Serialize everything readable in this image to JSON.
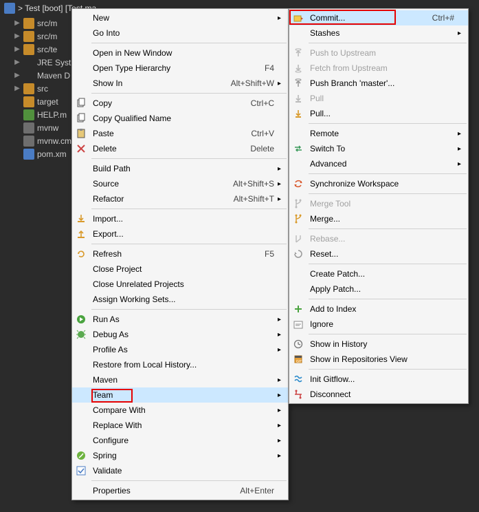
{
  "title_bar": {
    "text": "> Test [boot] [Test ma..."
  },
  "tree": [
    {
      "arrow": true,
      "icon": "pkg",
      "label": "src/m"
    },
    {
      "arrow": true,
      "icon": "pkg",
      "label": "src/m"
    },
    {
      "arrow": true,
      "icon": "pkg",
      "label": "src/te"
    },
    {
      "arrow": true,
      "icon": "jar",
      "label": "JRE Syst"
    },
    {
      "arrow": true,
      "icon": "jar",
      "label": "Maven D"
    },
    {
      "arrow": true,
      "icon": "folder",
      "label": "src"
    },
    {
      "arrow": false,
      "icon": "folder",
      "label": "target"
    },
    {
      "arrow": false,
      "icon": "green",
      "label": "HELP.m"
    },
    {
      "arrow": false,
      "icon": "txt",
      "label": "mvnw"
    },
    {
      "arrow": false,
      "icon": "txt",
      "label": "mvnw.cm"
    },
    {
      "arrow": false,
      "icon": "xml",
      "label": "pom.xm"
    }
  ],
  "primary_menu": [
    {
      "label": "New",
      "submenu": true
    },
    {
      "label": "Go Into"
    },
    {
      "sep": true
    },
    {
      "label": "Open in New Window"
    },
    {
      "label": "Open Type Hierarchy",
      "accel": "F4"
    },
    {
      "label": "Show In",
      "accel": "Alt+Shift+W",
      "submenu": true
    },
    {
      "sep": true
    },
    {
      "icon": "copy",
      "label": "Copy",
      "accel": "Ctrl+C"
    },
    {
      "icon": "copy",
      "label": "Copy Qualified Name"
    },
    {
      "icon": "paste",
      "label": "Paste",
      "accel": "Ctrl+V"
    },
    {
      "icon": "delete",
      "label": "Delete",
      "accel": "Delete"
    },
    {
      "sep": true
    },
    {
      "label": "Build Path",
      "submenu": true
    },
    {
      "label": "Source",
      "accel": "Alt+Shift+S",
      "submenu": true
    },
    {
      "label": "Refactor",
      "accel": "Alt+Shift+T",
      "submenu": true
    },
    {
      "sep": true
    },
    {
      "icon": "import",
      "label": "Import..."
    },
    {
      "icon": "export",
      "label": "Export..."
    },
    {
      "sep": true
    },
    {
      "icon": "refresh",
      "label": "Refresh",
      "accel": "F5"
    },
    {
      "label": "Close Project"
    },
    {
      "label": "Close Unrelated Projects"
    },
    {
      "label": "Assign Working Sets..."
    },
    {
      "sep": true
    },
    {
      "icon": "run",
      "label": "Run As",
      "submenu": true
    },
    {
      "icon": "debug",
      "label": "Debug As",
      "submenu": true
    },
    {
      "label": "Profile As",
      "submenu": true
    },
    {
      "label": "Restore from Local History..."
    },
    {
      "label": "Maven",
      "submenu": true
    },
    {
      "label": "Team",
      "submenu": true,
      "hover": true
    },
    {
      "label": "Compare With",
      "submenu": true
    },
    {
      "label": "Replace With",
      "submenu": true
    },
    {
      "label": "Configure",
      "submenu": true
    },
    {
      "icon": "spring",
      "label": "Spring",
      "submenu": true
    },
    {
      "icon": "check",
      "label": "Validate"
    },
    {
      "sep": true
    },
    {
      "label": "Properties",
      "accel": "Alt+Enter"
    }
  ],
  "secondary_menu": [
    {
      "icon": "commit",
      "label": "Commit...",
      "accel": "Ctrl+#",
      "hover": true
    },
    {
      "label": "Stashes",
      "submenu": true
    },
    {
      "sep": true
    },
    {
      "icon": "push",
      "label": "Push to Upstream",
      "disabled": true
    },
    {
      "icon": "fetch",
      "label": "Fetch from Upstream",
      "disabled": true
    },
    {
      "icon": "push",
      "label": "Push Branch 'master'..."
    },
    {
      "icon": "pull",
      "label": "Pull",
      "disabled": true
    },
    {
      "icon": "pull",
      "label": "Pull..."
    },
    {
      "sep": true
    },
    {
      "label": "Remote",
      "submenu": true
    },
    {
      "icon": "switch",
      "label": "Switch To",
      "submenu": true
    },
    {
      "label": "Advanced",
      "submenu": true
    },
    {
      "sep": true
    },
    {
      "icon": "sync",
      "label": "Synchronize Workspace"
    },
    {
      "sep": true
    },
    {
      "icon": "merge",
      "label": "Merge Tool",
      "disabled": true
    },
    {
      "icon": "merge",
      "label": "Merge..."
    },
    {
      "sep": true
    },
    {
      "icon": "rebase",
      "label": "Rebase...",
      "disabled": true
    },
    {
      "icon": "reset",
      "label": "Reset..."
    },
    {
      "sep": true
    },
    {
      "label": "Create Patch..."
    },
    {
      "label": "Apply Patch..."
    },
    {
      "sep": true
    },
    {
      "icon": "add",
      "label": "Add to Index"
    },
    {
      "icon": "ignore",
      "label": "Ignore"
    },
    {
      "sep": true
    },
    {
      "icon": "history",
      "label": "Show in History"
    },
    {
      "icon": "repo",
      "label": "Show in Repositories View"
    },
    {
      "sep": true
    },
    {
      "icon": "gitflow",
      "label": "Init Gitflow..."
    },
    {
      "icon": "disconnect",
      "label": "Disconnect"
    }
  ]
}
